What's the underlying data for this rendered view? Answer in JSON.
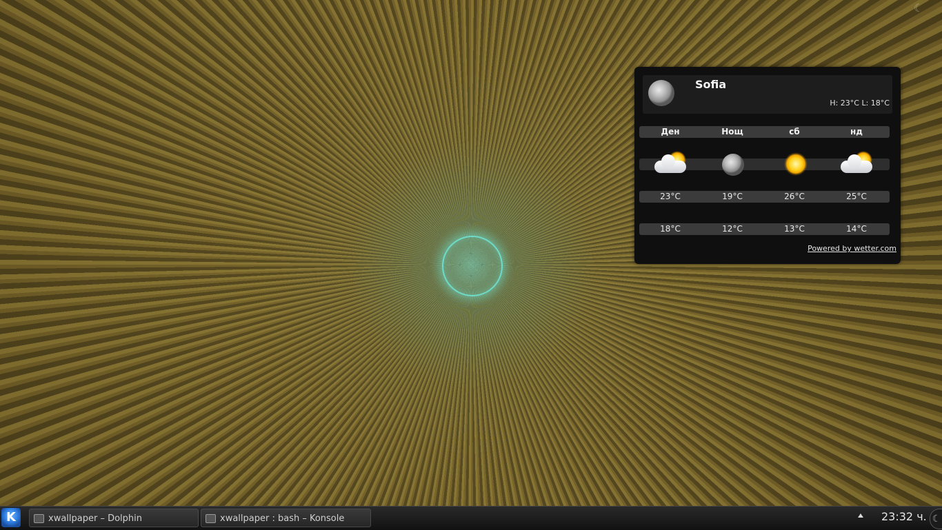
{
  "weather": {
    "city": "Sofia",
    "hilo": "H: 23°C L: 18°C",
    "current_icon": "moon-icon",
    "columns": [
      "Ден",
      "Нощ",
      "сб",
      "нд"
    ],
    "icons": [
      "partly-cloudy-day-icon",
      "moon-icon",
      "sun-icon",
      "partly-cloudy-day-icon"
    ],
    "highs": [
      "23°C",
      "19°C",
      "26°C",
      "25°C"
    ],
    "lows": [
      "18°C",
      "12°C",
      "13°C",
      "14°C"
    ],
    "powered_by": "Powered by wetter.com"
  },
  "taskbar": {
    "kmenu_label": "K",
    "tasks": [
      {
        "label": "xwallpaper – Dolphin",
        "icon": "folder-icon"
      },
      {
        "label": "xwallpaper : bash – Konsole",
        "icon": "terminal-icon"
      }
    ],
    "clock": "23:32 ч.",
    "tray_icon": "tray-expand-icon",
    "dashboard_icon": "plasma-toolbox-icon"
  },
  "desktop": {
    "toolbox_icon": "plasma-toolbox-icon"
  }
}
